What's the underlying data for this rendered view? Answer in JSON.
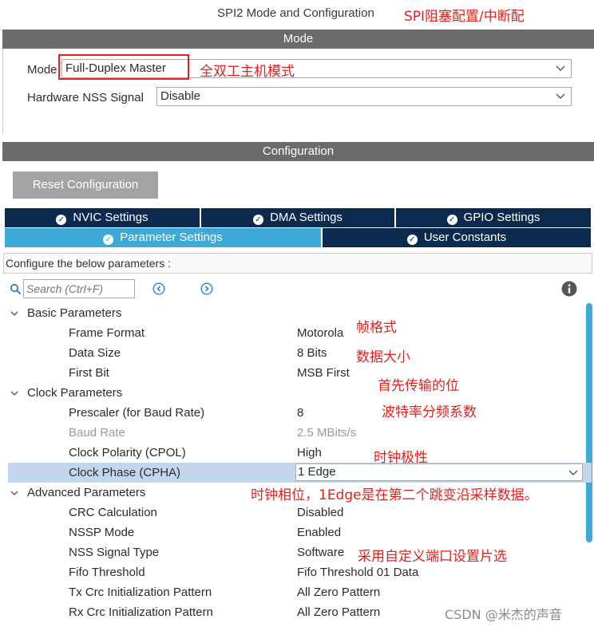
{
  "window": {
    "title": "SPI2 Mode and Configuration"
  },
  "annotations": {
    "title_note": "SPI阻塞配置/中断配",
    "mode_note": "全双工主机模式",
    "frame_note": "帧格式",
    "size_note": "数据大小",
    "firstbit_note": "首先传输的位",
    "prescaler_note": "波特率分频系数",
    "cpol_note": "时钟极性",
    "cpha_note": "时钟相位，1Edge是在第二个跳变沿采样数据。",
    "nss_note": "采用自定义端口设置片选"
  },
  "mode_section": {
    "header": "Mode",
    "mode_label": "Mode",
    "mode_value": "Full-Duplex Master",
    "nss_label": "Hardware NSS Signal",
    "nss_value": "Disable"
  },
  "config_section": {
    "header": "Configuration",
    "reset_button": "Reset Configuration",
    "tabs_row1": [
      "NVIC Settings",
      "DMA Settings",
      "GPIO Settings"
    ],
    "tabs_row2": [
      "Parameter Settings",
      "User Constants"
    ],
    "configure_text": "Configure the below parameters :",
    "search_placeholder": "Search (Ctrl+F)"
  },
  "params": {
    "basic": {
      "title": "Basic Parameters",
      "rows": [
        {
          "label": "Frame Format",
          "value": "Motorola"
        },
        {
          "label": "Data Size",
          "value": "8 Bits"
        },
        {
          "label": "First Bit",
          "value": "MSB First"
        }
      ]
    },
    "clock": {
      "title": "Clock Parameters",
      "rows": [
        {
          "label": "Prescaler (for Baud Rate)",
          "value": "8"
        },
        {
          "label": "Baud Rate",
          "value": "2.5 MBits/s"
        },
        {
          "label": "Clock Polarity (CPOL)",
          "value": "High"
        },
        {
          "label": "Clock Phase (CPHA)",
          "value": "1 Edge"
        }
      ]
    },
    "advanced": {
      "title": "Advanced Parameters",
      "rows": [
        {
          "label": "CRC Calculation",
          "value": "Disabled"
        },
        {
          "label": "NSSP Mode",
          "value": "Enabled"
        },
        {
          "label": "NSS Signal Type",
          "value": "Software"
        },
        {
          "label": "Fifo Threshold",
          "value": "Fifo Threshold 01 Data"
        },
        {
          "label": "Tx Crc Initialization Pattern",
          "value": "All Zero Pattern"
        },
        {
          "label": "Rx Crc Initialization Pattern",
          "value": "All Zero Pattern"
        }
      ]
    }
  },
  "watermark": "CSDN @米杰的声音",
  "colors": {
    "dark_tab": "#0c2a4e",
    "active_tab": "#3da9d9",
    "header_bar": "#6b6b6b",
    "annotation": "#e0211d",
    "selected_row": "#c3d7ec"
  }
}
